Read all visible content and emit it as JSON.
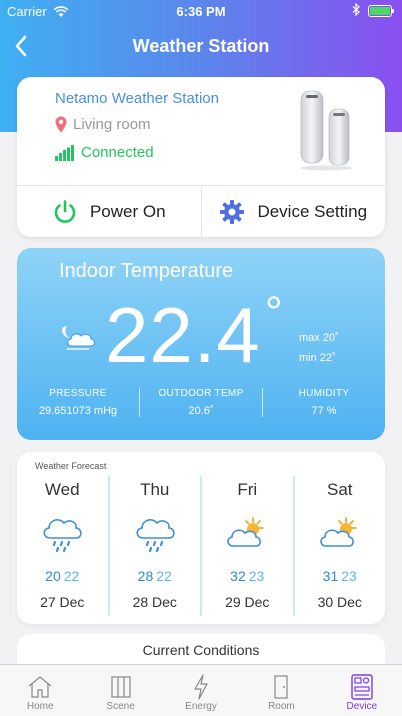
{
  "status_bar": {
    "carrier": "Carrier",
    "time": "6:36 PM"
  },
  "nav": {
    "title": "Weather Station"
  },
  "device": {
    "name": "Netamo Weather Station",
    "room": "Living room",
    "connection": "Connected",
    "power_label": "Power On",
    "setting_label": "Device Setting"
  },
  "indoor": {
    "title": "Indoor Temperature",
    "value": "22.4",
    "degree": "°",
    "max": "max 20˚",
    "min": "min 22˚",
    "stats": [
      {
        "label": "PRESSURE",
        "value": "29.651073 mHg"
      },
      {
        "label": "OUTDOOR TEMP",
        "value": "20.6˚"
      },
      {
        "label": "HUMIDITY",
        "value": "77 %"
      }
    ]
  },
  "forecast": {
    "label": "Weather Forecast",
    "days": [
      {
        "name": "Wed",
        "hi": "20",
        "lo": "22",
        "date": "27 Dec",
        "icon": "rain-cloud-icon"
      },
      {
        "name": "Thu",
        "hi": "28",
        "lo": "22",
        "date": "28 Dec",
        "icon": "rain-cloud-icon"
      },
      {
        "name": "Fri",
        "hi": "32",
        "lo": "23",
        "date": "29 Dec",
        "icon": "sun-cloud-icon"
      },
      {
        "name": "Sat",
        "hi": "31",
        "lo": "23",
        "date": "30 Dec",
        "icon": "sun-cloud-icon"
      }
    ]
  },
  "current": {
    "title": "Current Conditions"
  },
  "tabs": [
    {
      "label": "Home",
      "icon": "home-icon"
    },
    {
      "label": "Scene",
      "icon": "scene-icon"
    },
    {
      "label": "Energy",
      "icon": "energy-icon"
    },
    {
      "label": "Room",
      "icon": "room-icon"
    },
    {
      "label": "Device",
      "icon": "device-icon",
      "active": true
    }
  ],
  "colors": {
    "accent": "#7c3aed",
    "connected": "#22c55e",
    "link": "#4a8fd9"
  }
}
